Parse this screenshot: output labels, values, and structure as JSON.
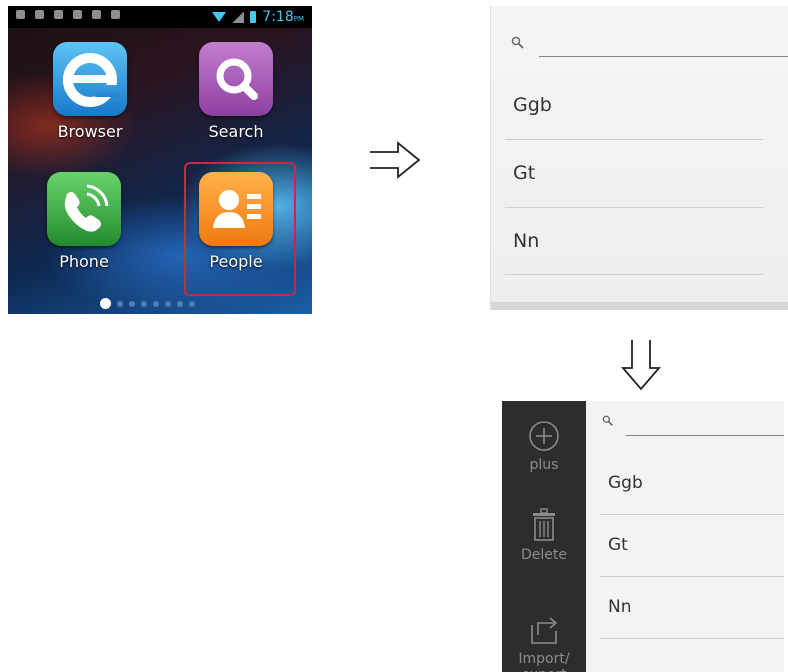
{
  "home": {
    "status_time": "7:18",
    "status_ampm": "PM",
    "apps": [
      {
        "label": "Browser"
      },
      {
        "label": "Search"
      },
      {
        "label": "Phone"
      },
      {
        "label": "People"
      }
    ],
    "page_dots": 8,
    "active_page": 1
  },
  "contacts": {
    "items": [
      "Ggb",
      "Gt",
      "Nn"
    ]
  },
  "menu": {
    "items": [
      {
        "label": "plus",
        "icon": "plus-circle-icon"
      },
      {
        "label": "Delete",
        "icon": "trash-icon"
      },
      {
        "label": "Import/\nexport",
        "icon": "import-export-icon"
      }
    ],
    "contacts": [
      "Ggb",
      "Gt",
      "Nn"
    ]
  },
  "colors": {
    "highlight_border": "#c0303c",
    "clock": "#45c8f0",
    "sidebar_bg": "#2d2d2d"
  }
}
